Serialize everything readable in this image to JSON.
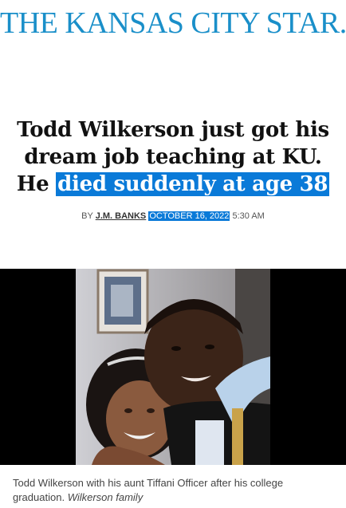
{
  "masthead": {
    "title": "THE KANSAS CITY STAR."
  },
  "article": {
    "headline_plain": "Todd Wilkerson just got his dream job teaching at KU. He",
    "headline_highlight": "died suddenly at age 38",
    "byline_prefix": "BY",
    "author": "J.M. BANKS",
    "date": "OCTOBER 16, 2022",
    "time": "5:30 AM"
  },
  "photo": {
    "caption": "Todd Wilkerson with his aunt Tiffani Officer after his college graduation.",
    "credit": "Wilkerson family"
  },
  "colors": {
    "brand": "#1a8fc9",
    "selection": "#0a7ad8"
  }
}
